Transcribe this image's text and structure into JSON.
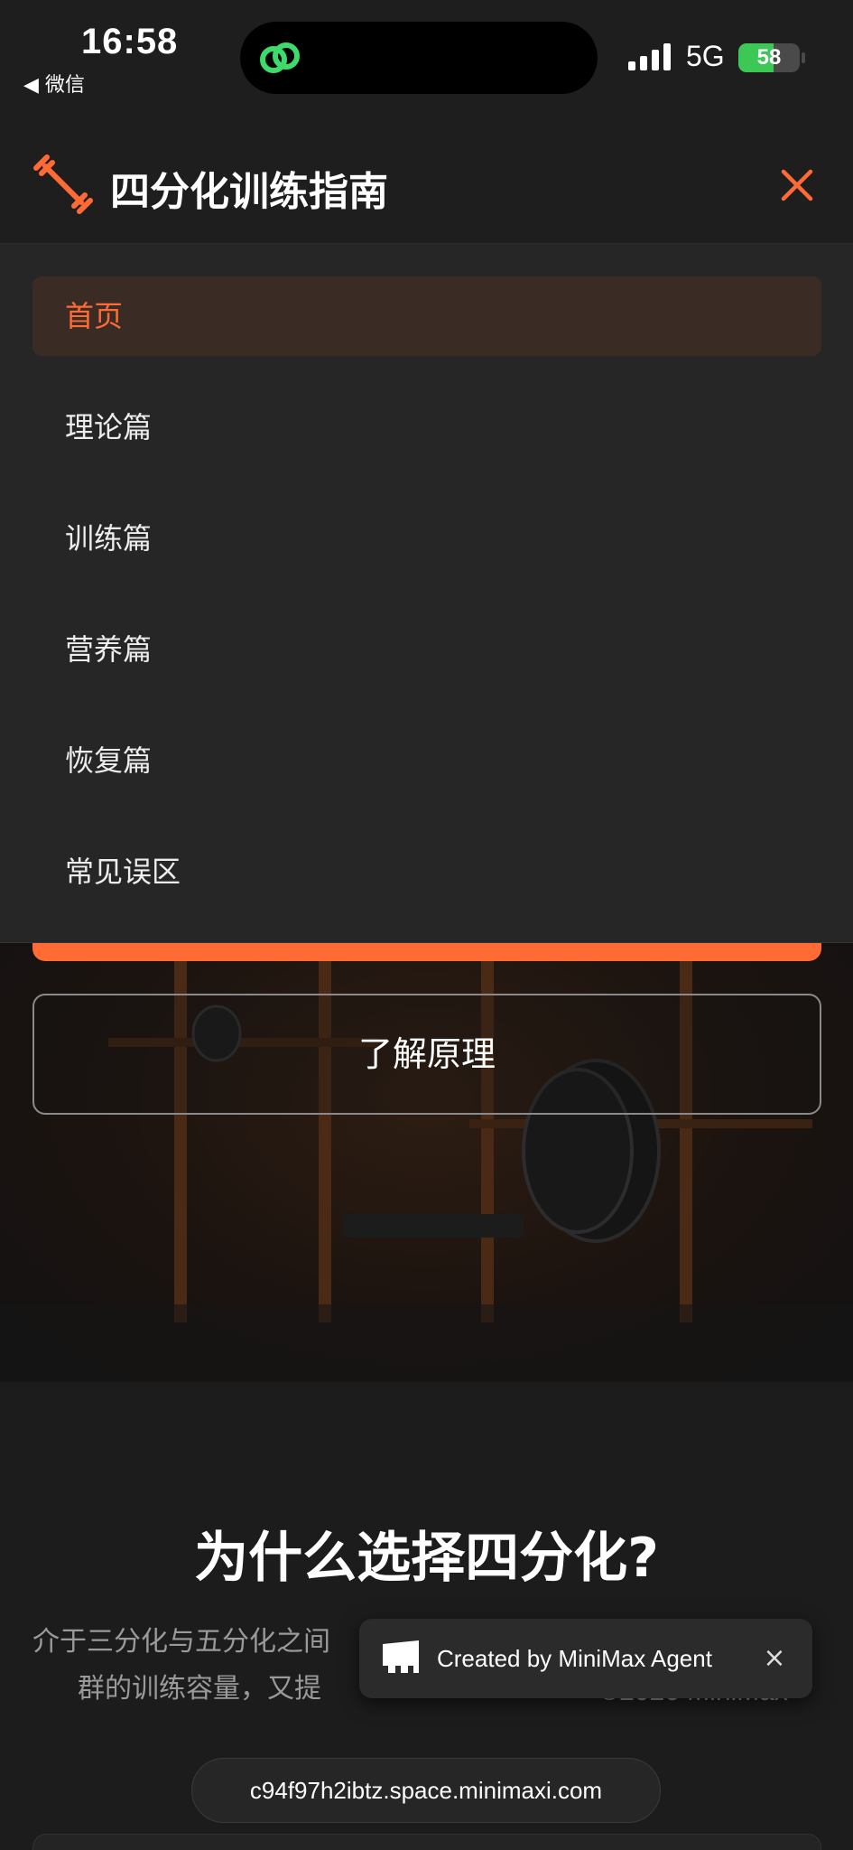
{
  "status_bar": {
    "time": "16:58",
    "back_app": "◀ 微信",
    "network": "5G",
    "battery": "58",
    "battery_level": 0.58
  },
  "header": {
    "title": "四分化训练指南",
    "logo_icon": "dumbbell-icon",
    "close_icon": "close-icon",
    "accent_color": "#ff6b35"
  },
  "menu": {
    "items": [
      {
        "label": "首页",
        "active": true
      },
      {
        "label": "理论篇",
        "active": false
      },
      {
        "label": "训练篇",
        "active": false
      },
      {
        "label": "营养篇",
        "active": false
      },
      {
        "label": "恢复篇",
        "active": false
      },
      {
        "label": "常见误区",
        "active": false
      }
    ]
  },
  "hero": {
    "secondary_button": "了解原理"
  },
  "why": {
    "title": "为什么选择四分化?",
    "line1": "介于三分化与五分化之间",
    "line2": "群的训练容量，又提"
  },
  "toast": {
    "text": "Created by MiniMax Agent",
    "close": "×"
  },
  "watermark": "©2026 MiniMax",
  "url": "c94f97h2ibtz.space.minimaxi.com"
}
